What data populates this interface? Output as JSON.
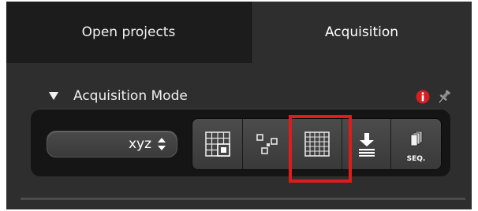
{
  "tabs": [
    {
      "label": "Open projects",
      "active": false
    },
    {
      "label": "Acquisition",
      "active": true
    }
  ],
  "section": {
    "title": "Acquisition Mode",
    "expanded": true
  },
  "mode_select": {
    "value": "xyz"
  },
  "mode_buttons": [
    {
      "icon": "tile-scan-icon"
    },
    {
      "icon": "mark-and-find-icon"
    },
    {
      "icon": "grid-scan-icon",
      "highlighted": true
    },
    {
      "icon": "download-stack-icon"
    },
    {
      "icon": "sequence-icon",
      "label": "SEQ."
    }
  ],
  "colors": {
    "panel_bg": "#2e2e2e",
    "inactive_tab_bg": "#1c1c1c",
    "toolbar_bg": "#151515",
    "highlight": "#e01b1b",
    "info_red": "#d42020"
  }
}
